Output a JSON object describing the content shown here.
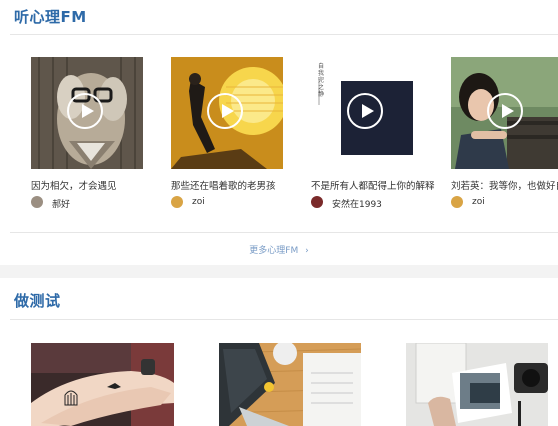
{
  "fm": {
    "title": "听心理FM",
    "more_link": "更多心理FM",
    "cards": [
      {
        "title": "因为相欠，才会遇见",
        "author": "郝好",
        "icon": "play-icon",
        "colors": {
          "bg": "#6f6558",
          "accent": "#c7bfb1"
        }
      },
      {
        "title": "那些还在唱着歌的老男孩",
        "author": "zoi",
        "icon": "play-icon",
        "colors": {
          "bg": "#d29b22",
          "accent": "#f8de55"
        }
      },
      {
        "title": "不是所有人都配得上你的解释",
        "author": "安然在1993",
        "icon": "play-icon",
        "colors": {
          "bg": "#ffffff",
          "accent": "#1d2438"
        },
        "caption": "自我完之静"
      },
      {
        "title": "刘若英：我等你，也做好自己",
        "author": "zoi",
        "icon": "play-icon",
        "colors": {
          "bg": "#56704e",
          "accent": "#3a4a3a"
        }
      }
    ]
  },
  "test": {
    "title": "做测试"
  },
  "colors": {
    "brand": "#2e6aa8",
    "link": "#7a9cc6",
    "divider": "#e6e6e6"
  }
}
